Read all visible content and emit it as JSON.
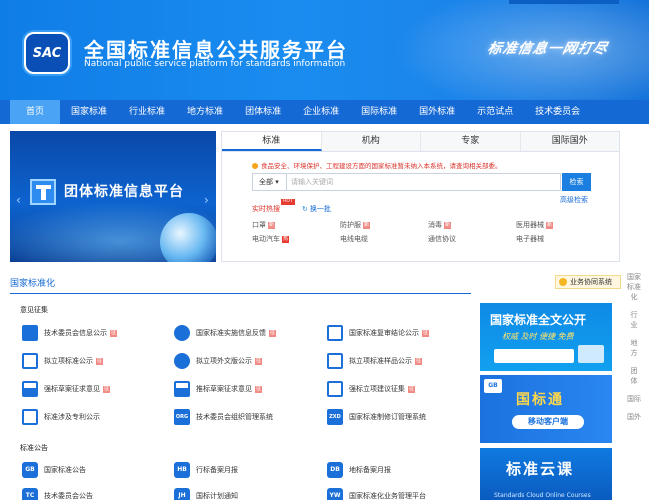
{
  "header": {
    "logo_text": "SAC",
    "title": "全国标准信息公共服务平台",
    "subtitle": "National public service platform  for standards information",
    "slogan": "标准信息一网打尽"
  },
  "nav": [
    "首页",
    "国家标准",
    "行业标准",
    "地方标准",
    "团体标准",
    "企业标准",
    "国际标准",
    "国外标准",
    "示范试点",
    "技术委员会"
  ],
  "banner": {
    "title": "团体标准信息平台",
    "prev": "‹",
    "next": "›"
  },
  "search": {
    "tabs": [
      "标准",
      "机构",
      "专家",
      "国际国外"
    ],
    "notice": "食品安全、环境保护、工程建设方面的国家标准暂未纳入本系统，请查询相关部委。",
    "scope": "全部 ▾",
    "placeholder": "请输入关键词",
    "button": "检索",
    "advanced": "高级检索",
    "hot_label": "实时热搜",
    "hot_badge": "HOT",
    "swap_icon": "↻",
    "swap": "换一批",
    "keywords": [
      {
        "text": "口罩",
        "badge": "新"
      },
      {
        "text": "防护服",
        "badge": "新"
      },
      {
        "text": "消毒",
        "badge": "新"
      },
      {
        "text": "医用器械",
        "badge": "新"
      },
      {
        "text": "电动汽车",
        "badge": "热"
      },
      {
        "text": "电线电缆",
        "badge": ""
      },
      {
        "text": "通信协议",
        "badge": ""
      },
      {
        "text": "电子器械",
        "badge": ""
      }
    ]
  },
  "section": {
    "title": "国家标准化",
    "collab_button": "业务协同系统",
    "side_links": [
      "国家",
      "标准",
      "化",
      "行",
      "业",
      "地",
      "方",
      "团",
      "体",
      "国际",
      "国外"
    ]
  },
  "group1": {
    "title": "意见征集",
    "items": [
      {
        "label": "技术委员会信息公示",
        "mark": "征"
      },
      {
        "label": "国家标准实施信息反馈",
        "mark": "征"
      },
      {
        "label": "国家标准复审结论公示",
        "mark": "征"
      },
      {
        "label": "拟立项标准公示",
        "mark": "征"
      },
      {
        "label": "拟立项外文版公示",
        "mark": "征"
      },
      {
        "label": "拟立项标准样品公示",
        "mark": "征"
      },
      {
        "label": "强标草案征求意见",
        "mark": "征"
      },
      {
        "label": "推标草案征求意见",
        "mark": "征"
      },
      {
        "label": "强标立项建议征集",
        "mark": "征"
      },
      {
        "label": "标准涉及专利公示",
        "mark": ""
      },
      {
        "label": "技术委员会组织管理系统",
        "mark": ""
      },
      {
        "label": "国家标准制修订管理系统",
        "mark": ""
      }
    ],
    "icon_texts": {
      "org": "ORG",
      "zxd": "ZXD"
    }
  },
  "group2": {
    "title": "标准公告",
    "items": [
      {
        "label": "国家标准公告",
        "icon": "GB"
      },
      {
        "label": "行标备案月报",
        "icon": "HB"
      },
      {
        "label": "地标备案月报",
        "icon": "DB"
      },
      {
        "label": "技术委员会公告",
        "icon": "TC"
      },
      {
        "label": "国标计划通知",
        "icon": "JH"
      },
      {
        "label": "国家标准化业务管理平台",
        "icon": "YW"
      }
    ]
  },
  "promos": {
    "p1_title": "国家标准全文公开",
    "p1_sub": "权威  及时  便捷  免费",
    "p2_logo": "GB",
    "p2_title": "国标通",
    "p2_sub": "移动客户端",
    "p3_title": "标准云课",
    "p3_sub": "Standards Cloud Online Courses"
  }
}
